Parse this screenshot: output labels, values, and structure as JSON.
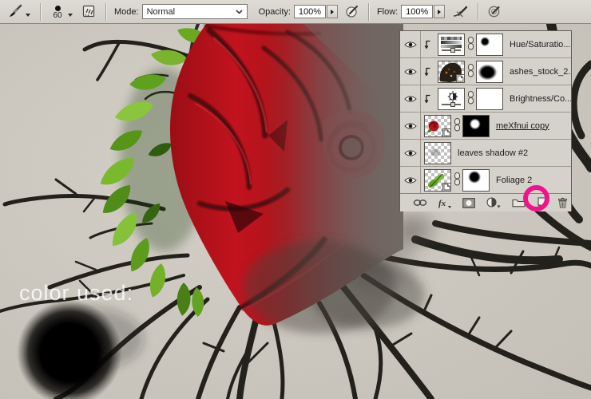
{
  "toolbar": {
    "tool": "brush",
    "brush_size": "60",
    "mode_label": "Mode:",
    "mode_value": "Normal",
    "opacity_label": "Opacity:",
    "opacity_value": "100%",
    "flow_label": "Flow:",
    "flow_value": "100%"
  },
  "canvas": {
    "annotation_text": "color used:",
    "brush_color_swatch": "#000000"
  },
  "layers_panel": {
    "layers": [
      {
        "name": "Hue/Saturatio...",
        "kind": "hue-saturation-adjustment",
        "clipped": true,
        "visible": true,
        "active": false
      },
      {
        "name": "ashes_stock_2...",
        "kind": "smart-object",
        "clipped": true,
        "visible": true,
        "active": false
      },
      {
        "name": "Brightness/Co...",
        "kind": "brightness-contrast-adjustment",
        "clipped": true,
        "visible": true,
        "active": false
      },
      {
        "name": "meXfnui copy",
        "kind": "smart-object",
        "clipped": false,
        "visible": true,
        "active": true
      },
      {
        "name": "leaves shadow #2",
        "kind": "pixel",
        "clipped": false,
        "visible": true,
        "active": false
      },
      {
        "name": "Foliage 2",
        "kind": "smart-object",
        "clipped": false,
        "visible": true,
        "active": false
      }
    ],
    "footer_buttons": [
      "link-layers",
      "layer-styles",
      "add-layer-mask",
      "new-adjustment-layer",
      "new-group",
      "new-layer",
      "delete-layer"
    ],
    "highlighted_button": "new-layer"
  },
  "colors": {
    "highlight_ring": "#f0148c",
    "panel_bg": "#d5d2cb",
    "canvas_bg": "#cfcbc3",
    "rose_red": "#c41420",
    "leaf_green": "#76b22a",
    "swatch_black": "#000000"
  }
}
